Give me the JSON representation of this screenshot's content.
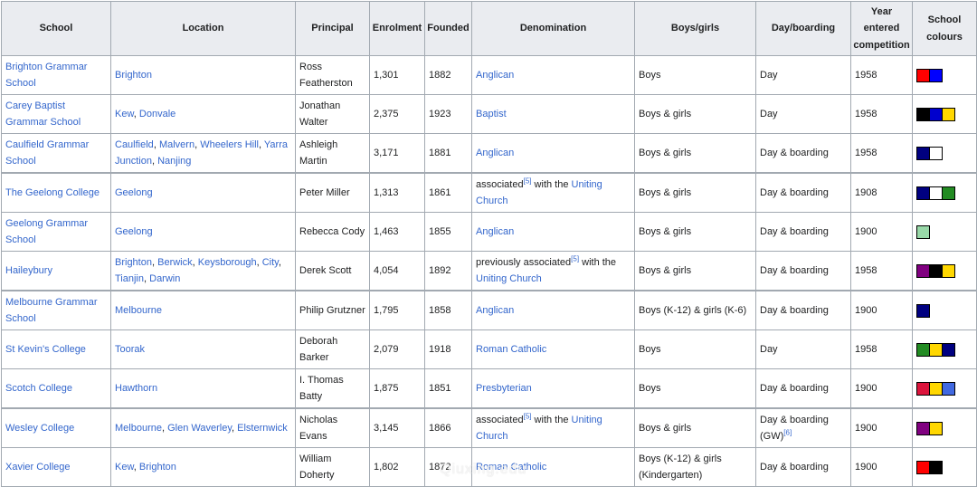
{
  "headers": {
    "school": "School",
    "location": "Location",
    "principal": "Principal",
    "enrolment": "Enrolment",
    "founded": "Founded",
    "denomination": "Denomination",
    "boys_girls": "Boys/girls",
    "day_boarding": "Day/boarding",
    "year_entered": "Year entered competition",
    "colours": "School colours"
  },
  "rows": [
    {
      "school": "Brighton Grammar School",
      "location": [
        {
          "text": "Brighton",
          "link": true
        }
      ],
      "principal": "Ross Featherston",
      "enrolment": "1,301",
      "founded": "1882",
      "denomination": [
        {
          "text": "Anglican",
          "link": true
        }
      ],
      "gender": "Boys",
      "boarding": [
        {
          "text": "Day"
        }
      ],
      "year": "1958",
      "colours": [
        "#ff0000",
        "#0000ff"
      ]
    },
    {
      "school": "Carey Baptist Grammar School",
      "location": [
        {
          "text": "Kew",
          "link": true
        },
        {
          "text": ", "
        },
        {
          "text": "Donvale",
          "link": true
        }
      ],
      "principal": "Jonathan Walter",
      "enrolment": "2,375",
      "founded": "1923",
      "denomination": [
        {
          "text": "Baptist",
          "link": true
        }
      ],
      "gender": "Boys & girls",
      "boarding": [
        {
          "text": "Day"
        }
      ],
      "year": "1958",
      "colours": [
        "#000000",
        "#0000cd",
        "#ffd700"
      ]
    },
    {
      "school": "Caulfield Grammar School",
      "location": [
        {
          "text": "Caulfield",
          "link": true
        },
        {
          "text": ", "
        },
        {
          "text": "Malvern",
          "link": true
        },
        {
          "text": ", "
        },
        {
          "text": "Wheelers Hill",
          "link": true
        },
        {
          "text": ", "
        },
        {
          "text": "Yarra Junction",
          "link": true
        },
        {
          "text": ", "
        },
        {
          "text": "Nanjing",
          "link": true
        }
      ],
      "principal": "Ashleigh Martin",
      "enrolment": "3,171",
      "founded": "1881",
      "denomination": [
        {
          "text": "Anglican",
          "link": true
        }
      ],
      "gender": "Boys & girls",
      "boarding": [
        {
          "text": "Day & boarding"
        }
      ],
      "year": "1958",
      "colours": [
        "#000080",
        "#ffffff"
      ]
    },
    {
      "school": "The Geelong College",
      "location": [
        {
          "text": "Geelong",
          "link": true
        }
      ],
      "principal": "Peter Miller",
      "enrolment": "1,313",
      "founded": "1861",
      "denomination": [
        {
          "text": "associated"
        },
        {
          "text": "[5]",
          "sup": true,
          "link": true
        },
        {
          "text": " with the "
        },
        {
          "text": "Uniting Church",
          "link": true
        }
      ],
      "gender": "Boys & girls",
      "boarding": [
        {
          "text": "Day & boarding"
        }
      ],
      "year": "1908",
      "colours": [
        "#000080",
        "#ffffff",
        "#228b22"
      ]
    },
    {
      "school": "Geelong Grammar School",
      "location": [
        {
          "text": "Geelong",
          "link": true
        }
      ],
      "principal": "Rebecca Cody",
      "enrolment": "1,463",
      "founded": "1855",
      "denomination": [
        {
          "text": "Anglican",
          "link": true
        }
      ],
      "gender": "Boys & girls",
      "boarding": [
        {
          "text": "Day & boarding"
        }
      ],
      "year": "1900",
      "colours": [
        "#98d8a8"
      ]
    },
    {
      "school": "Haileybury",
      "location": [
        {
          "text": "Brighton",
          "link": true
        },
        {
          "text": ", "
        },
        {
          "text": "Berwick",
          "link": true
        },
        {
          "text": ", "
        },
        {
          "text": "Keysborough",
          "link": true
        },
        {
          "text": ", "
        },
        {
          "text": "City",
          "link": true
        },
        {
          "text": ", "
        },
        {
          "text": "Tianjin",
          "link": true
        },
        {
          "text": ", "
        },
        {
          "text": "Darwin",
          "link": true
        }
      ],
      "principal": "Derek Scott",
      "enrolment": "4,054",
      "founded": "1892",
      "denomination": [
        {
          "text": "previously associated"
        },
        {
          "text": "[5]",
          "sup": true,
          "link": true
        },
        {
          "text": " with the "
        },
        {
          "text": "Uniting Church",
          "link": true
        }
      ],
      "gender": "Boys & girls",
      "boarding": [
        {
          "text": "Day & boarding"
        }
      ],
      "year": "1958",
      "colours": [
        "#800080",
        "#000000",
        "#ffd700"
      ]
    },
    {
      "school": "Melbourne Grammar School",
      "location": [
        {
          "text": "Melbourne",
          "link": true
        }
      ],
      "principal": "Philip Grutzner",
      "enrolment": "1,795",
      "founded": "1858",
      "denomination": [
        {
          "text": "Anglican",
          "link": true
        }
      ],
      "gender": "Boys (K-12) & girls (K-6)",
      "boarding": [
        {
          "text": "Day & boarding"
        }
      ],
      "year": "1900",
      "colours": [
        "#000080"
      ]
    },
    {
      "school": "St Kevin's College",
      "location": [
        {
          "text": "Toorak",
          "link": true
        }
      ],
      "principal": "Deborah Barker",
      "enrolment": "2,079",
      "founded": "1918",
      "denomination": [
        {
          "text": "Roman Catholic",
          "link": true
        }
      ],
      "gender": "Boys",
      "boarding": [
        {
          "text": "Day"
        }
      ],
      "year": "1958",
      "colours": [
        "#228b22",
        "#ffd700",
        "#000080"
      ]
    },
    {
      "school": "Scotch College",
      "location": [
        {
          "text": "Hawthorn",
          "link": true
        }
      ],
      "principal": "I. Thomas Batty",
      "enrolment": "1,875",
      "founded": "1851",
      "denomination": [
        {
          "text": "Presbyterian",
          "link": true
        }
      ],
      "gender": "Boys",
      "boarding": [
        {
          "text": "Day & boarding"
        }
      ],
      "year": "1900",
      "colours": [
        "#dc143c",
        "#ffd700",
        "#4169e1"
      ]
    },
    {
      "school": "Wesley College",
      "location": [
        {
          "text": "Melbourne",
          "link": true
        },
        {
          "text": ", "
        },
        {
          "text": "Glen Waverley",
          "link": true
        },
        {
          "text": ", "
        },
        {
          "text": "Elsternwick",
          "link": true
        }
      ],
      "principal": "Nicholas Evans",
      "enrolment": "3,145",
      "founded": "1866",
      "denomination": [
        {
          "text": "associated"
        },
        {
          "text": "[5]",
          "sup": true,
          "link": true
        },
        {
          "text": " with the "
        },
        {
          "text": "Uniting Church",
          "link": true
        }
      ],
      "gender": "Boys & girls",
      "boarding": [
        {
          "text": "Day & boarding (GW)"
        },
        {
          "text": "[6]",
          "sup": true,
          "link": true
        }
      ],
      "year": "1900",
      "colours": [
        "#800080",
        "#ffd700"
      ]
    },
    {
      "school": "Xavier College",
      "location": [
        {
          "text": "Kew",
          "link": true
        },
        {
          "text": ", "
        },
        {
          "text": "Brighton",
          "link": true
        }
      ],
      "principal": "William Doherty",
      "enrolment": "1,802",
      "founded": "1872",
      "denomination": [
        {
          "text": "Roman Catholic",
          "link": true
        }
      ],
      "gender": "Boys (K-12) & girls (Kindergarten)",
      "boarding": [
        {
          "text": "Day & boarding"
        }
      ],
      "year": "1900",
      "colours": [
        "#ff0000",
        "#000000"
      ]
    }
  ],
  "watermark": "Qiuxing.edu"
}
